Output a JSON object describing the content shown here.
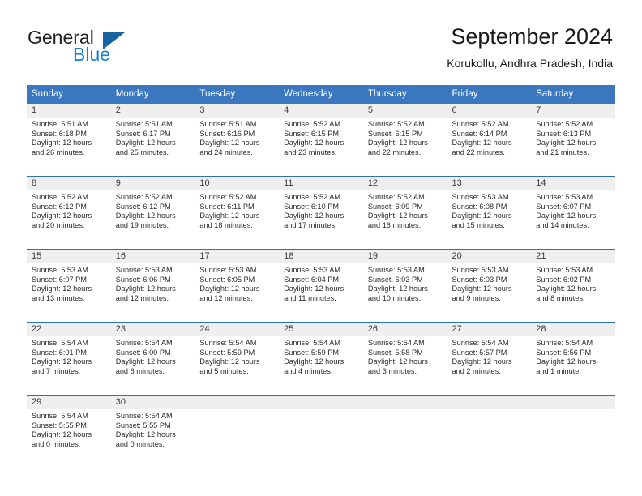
{
  "brand": {
    "name_top": "General",
    "name_bottom": "Blue",
    "accent_color": "#1a7fd4",
    "triangle_color": "#15639f"
  },
  "header": {
    "title": "September 2024",
    "subtitle": "Korukollu, Andhra Pradesh, India"
  },
  "calendar": {
    "header_color": "#3a77bf",
    "weekday_headers": [
      "Sunday",
      "Monday",
      "Tuesday",
      "Wednesday",
      "Thursday",
      "Friday",
      "Saturday"
    ],
    "weeks": [
      [
        {
          "day": "1",
          "sunrise": "Sunrise: 5:51 AM",
          "sunset": "Sunset: 6:18 PM",
          "daylight_line1": "Daylight: 12 hours",
          "daylight_line2": "and 26 minutes."
        },
        {
          "day": "2",
          "sunrise": "Sunrise: 5:51 AM",
          "sunset": "Sunset: 6:17 PM",
          "daylight_line1": "Daylight: 12 hours",
          "daylight_line2": "and 25 minutes."
        },
        {
          "day": "3",
          "sunrise": "Sunrise: 5:51 AM",
          "sunset": "Sunset: 6:16 PM",
          "daylight_line1": "Daylight: 12 hours",
          "daylight_line2": "and 24 minutes."
        },
        {
          "day": "4",
          "sunrise": "Sunrise: 5:52 AM",
          "sunset": "Sunset: 6:15 PM",
          "daylight_line1": "Daylight: 12 hours",
          "daylight_line2": "and 23 minutes."
        },
        {
          "day": "5",
          "sunrise": "Sunrise: 5:52 AM",
          "sunset": "Sunset: 6:15 PM",
          "daylight_line1": "Daylight: 12 hours",
          "daylight_line2": "and 22 minutes."
        },
        {
          "day": "6",
          "sunrise": "Sunrise: 5:52 AM",
          "sunset": "Sunset: 6:14 PM",
          "daylight_line1": "Daylight: 12 hours",
          "daylight_line2": "and 22 minutes."
        },
        {
          "day": "7",
          "sunrise": "Sunrise: 5:52 AM",
          "sunset": "Sunset: 6:13 PM",
          "daylight_line1": "Daylight: 12 hours",
          "daylight_line2": "and 21 minutes."
        }
      ],
      [
        {
          "day": "8",
          "sunrise": "Sunrise: 5:52 AM",
          "sunset": "Sunset: 6:12 PM",
          "daylight_line1": "Daylight: 12 hours",
          "daylight_line2": "and 20 minutes."
        },
        {
          "day": "9",
          "sunrise": "Sunrise: 5:52 AM",
          "sunset": "Sunset: 6:12 PM",
          "daylight_line1": "Daylight: 12 hours",
          "daylight_line2": "and 19 minutes."
        },
        {
          "day": "10",
          "sunrise": "Sunrise: 5:52 AM",
          "sunset": "Sunset: 6:11 PM",
          "daylight_line1": "Daylight: 12 hours",
          "daylight_line2": "and 18 minutes."
        },
        {
          "day": "11",
          "sunrise": "Sunrise: 5:52 AM",
          "sunset": "Sunset: 6:10 PM",
          "daylight_line1": "Daylight: 12 hours",
          "daylight_line2": "and 17 minutes."
        },
        {
          "day": "12",
          "sunrise": "Sunrise: 5:52 AM",
          "sunset": "Sunset: 6:09 PM",
          "daylight_line1": "Daylight: 12 hours",
          "daylight_line2": "and 16 minutes."
        },
        {
          "day": "13",
          "sunrise": "Sunrise: 5:53 AM",
          "sunset": "Sunset: 6:08 PM",
          "daylight_line1": "Daylight: 12 hours",
          "daylight_line2": "and 15 minutes."
        },
        {
          "day": "14",
          "sunrise": "Sunrise: 5:53 AM",
          "sunset": "Sunset: 6:07 PM",
          "daylight_line1": "Daylight: 12 hours",
          "daylight_line2": "and 14 minutes."
        }
      ],
      [
        {
          "day": "15",
          "sunrise": "Sunrise: 5:53 AM",
          "sunset": "Sunset: 6:07 PM",
          "daylight_line1": "Daylight: 12 hours",
          "daylight_line2": "and 13 minutes."
        },
        {
          "day": "16",
          "sunrise": "Sunrise: 5:53 AM",
          "sunset": "Sunset: 6:06 PM",
          "daylight_line1": "Daylight: 12 hours",
          "daylight_line2": "and 12 minutes."
        },
        {
          "day": "17",
          "sunrise": "Sunrise: 5:53 AM",
          "sunset": "Sunset: 6:05 PM",
          "daylight_line1": "Daylight: 12 hours",
          "daylight_line2": "and 12 minutes."
        },
        {
          "day": "18",
          "sunrise": "Sunrise: 5:53 AM",
          "sunset": "Sunset: 6:04 PM",
          "daylight_line1": "Daylight: 12 hours",
          "daylight_line2": "and 11 minutes."
        },
        {
          "day": "19",
          "sunrise": "Sunrise: 5:53 AM",
          "sunset": "Sunset: 6:03 PM",
          "daylight_line1": "Daylight: 12 hours",
          "daylight_line2": "and 10 minutes."
        },
        {
          "day": "20",
          "sunrise": "Sunrise: 5:53 AM",
          "sunset": "Sunset: 6:03 PM",
          "daylight_line1": "Daylight: 12 hours",
          "daylight_line2": "and 9 minutes."
        },
        {
          "day": "21",
          "sunrise": "Sunrise: 5:53 AM",
          "sunset": "Sunset: 6:02 PM",
          "daylight_line1": "Daylight: 12 hours",
          "daylight_line2": "and 8 minutes."
        }
      ],
      [
        {
          "day": "22",
          "sunrise": "Sunrise: 5:54 AM",
          "sunset": "Sunset: 6:01 PM",
          "daylight_line1": "Daylight: 12 hours",
          "daylight_line2": "and 7 minutes."
        },
        {
          "day": "23",
          "sunrise": "Sunrise: 5:54 AM",
          "sunset": "Sunset: 6:00 PM",
          "daylight_line1": "Daylight: 12 hours",
          "daylight_line2": "and 6 minutes."
        },
        {
          "day": "24",
          "sunrise": "Sunrise: 5:54 AM",
          "sunset": "Sunset: 5:59 PM",
          "daylight_line1": "Daylight: 12 hours",
          "daylight_line2": "and 5 minutes."
        },
        {
          "day": "25",
          "sunrise": "Sunrise: 5:54 AM",
          "sunset": "Sunset: 5:59 PM",
          "daylight_line1": "Daylight: 12 hours",
          "daylight_line2": "and 4 minutes."
        },
        {
          "day": "26",
          "sunrise": "Sunrise: 5:54 AM",
          "sunset": "Sunset: 5:58 PM",
          "daylight_line1": "Daylight: 12 hours",
          "daylight_line2": "and 3 minutes."
        },
        {
          "day": "27",
          "sunrise": "Sunrise: 5:54 AM",
          "sunset": "Sunset: 5:57 PM",
          "daylight_line1": "Daylight: 12 hours",
          "daylight_line2": "and 2 minutes."
        },
        {
          "day": "28",
          "sunrise": "Sunrise: 5:54 AM",
          "sunset": "Sunset: 5:56 PM",
          "daylight_line1": "Daylight: 12 hours",
          "daylight_line2": "and 1 minute."
        }
      ],
      [
        {
          "day": "29",
          "sunrise": "Sunrise: 5:54 AM",
          "sunset": "Sunset: 5:55 PM",
          "daylight_line1": "Daylight: 12 hours",
          "daylight_line2": "and 0 minutes."
        },
        {
          "day": "30",
          "sunrise": "Sunrise: 5:54 AM",
          "sunset": "Sunset: 5:55 PM",
          "daylight_line1": "Daylight: 12 hours",
          "daylight_line2": "and 0 minutes."
        },
        {
          "day": "",
          "sunrise": "",
          "sunset": "",
          "daylight_line1": "",
          "daylight_line2": ""
        },
        {
          "day": "",
          "sunrise": "",
          "sunset": "",
          "daylight_line1": "",
          "daylight_line2": ""
        },
        {
          "day": "",
          "sunrise": "",
          "sunset": "",
          "daylight_line1": "",
          "daylight_line2": ""
        },
        {
          "day": "",
          "sunrise": "",
          "sunset": "",
          "daylight_line1": "",
          "daylight_line2": ""
        },
        {
          "day": "",
          "sunrise": "",
          "sunset": "",
          "daylight_line1": "",
          "daylight_line2": ""
        }
      ]
    ]
  }
}
